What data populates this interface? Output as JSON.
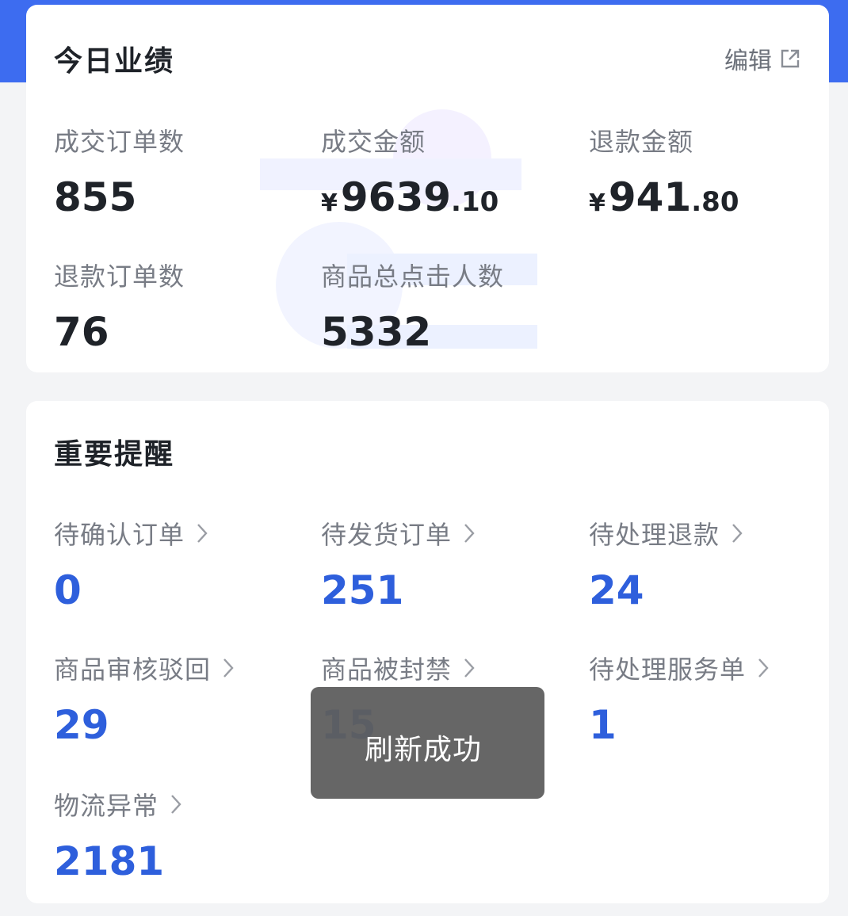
{
  "today": {
    "title": "今日业绩",
    "edit_label": "编辑",
    "metrics": [
      {
        "label": "成交订单数",
        "value": "855"
      },
      {
        "label": "成交金额",
        "currency": "¥",
        "int": "9639",
        "dec": ".10"
      },
      {
        "label": "退款金额",
        "currency": "¥",
        "int": "941",
        "dec": ".80"
      },
      {
        "label": "退款订单数",
        "value": "76"
      },
      {
        "label": "商品总点击人数",
        "value": "5332"
      }
    ]
  },
  "reminders": {
    "title": "重要提醒",
    "items": [
      {
        "label": "待确认订单",
        "value": "0"
      },
      {
        "label": "待发货订单",
        "value": "251"
      },
      {
        "label": "待处理退款",
        "value": "24"
      },
      {
        "label": "商品审核驳回",
        "value": "29"
      },
      {
        "label": "商品被封禁",
        "value": "15"
      },
      {
        "label": "待处理服务单",
        "value": "1"
      },
      {
        "label": "物流异常",
        "value": "2181"
      }
    ]
  },
  "toast": {
    "text": "刷新成功"
  },
  "colors": {
    "accent": "#3d6cf0",
    "value_blue": "#2e5fdc",
    "label_gray": "#787c85"
  },
  "icons": {
    "edit": "external-edit-icon",
    "chevron": "chevron-right-icon"
  }
}
